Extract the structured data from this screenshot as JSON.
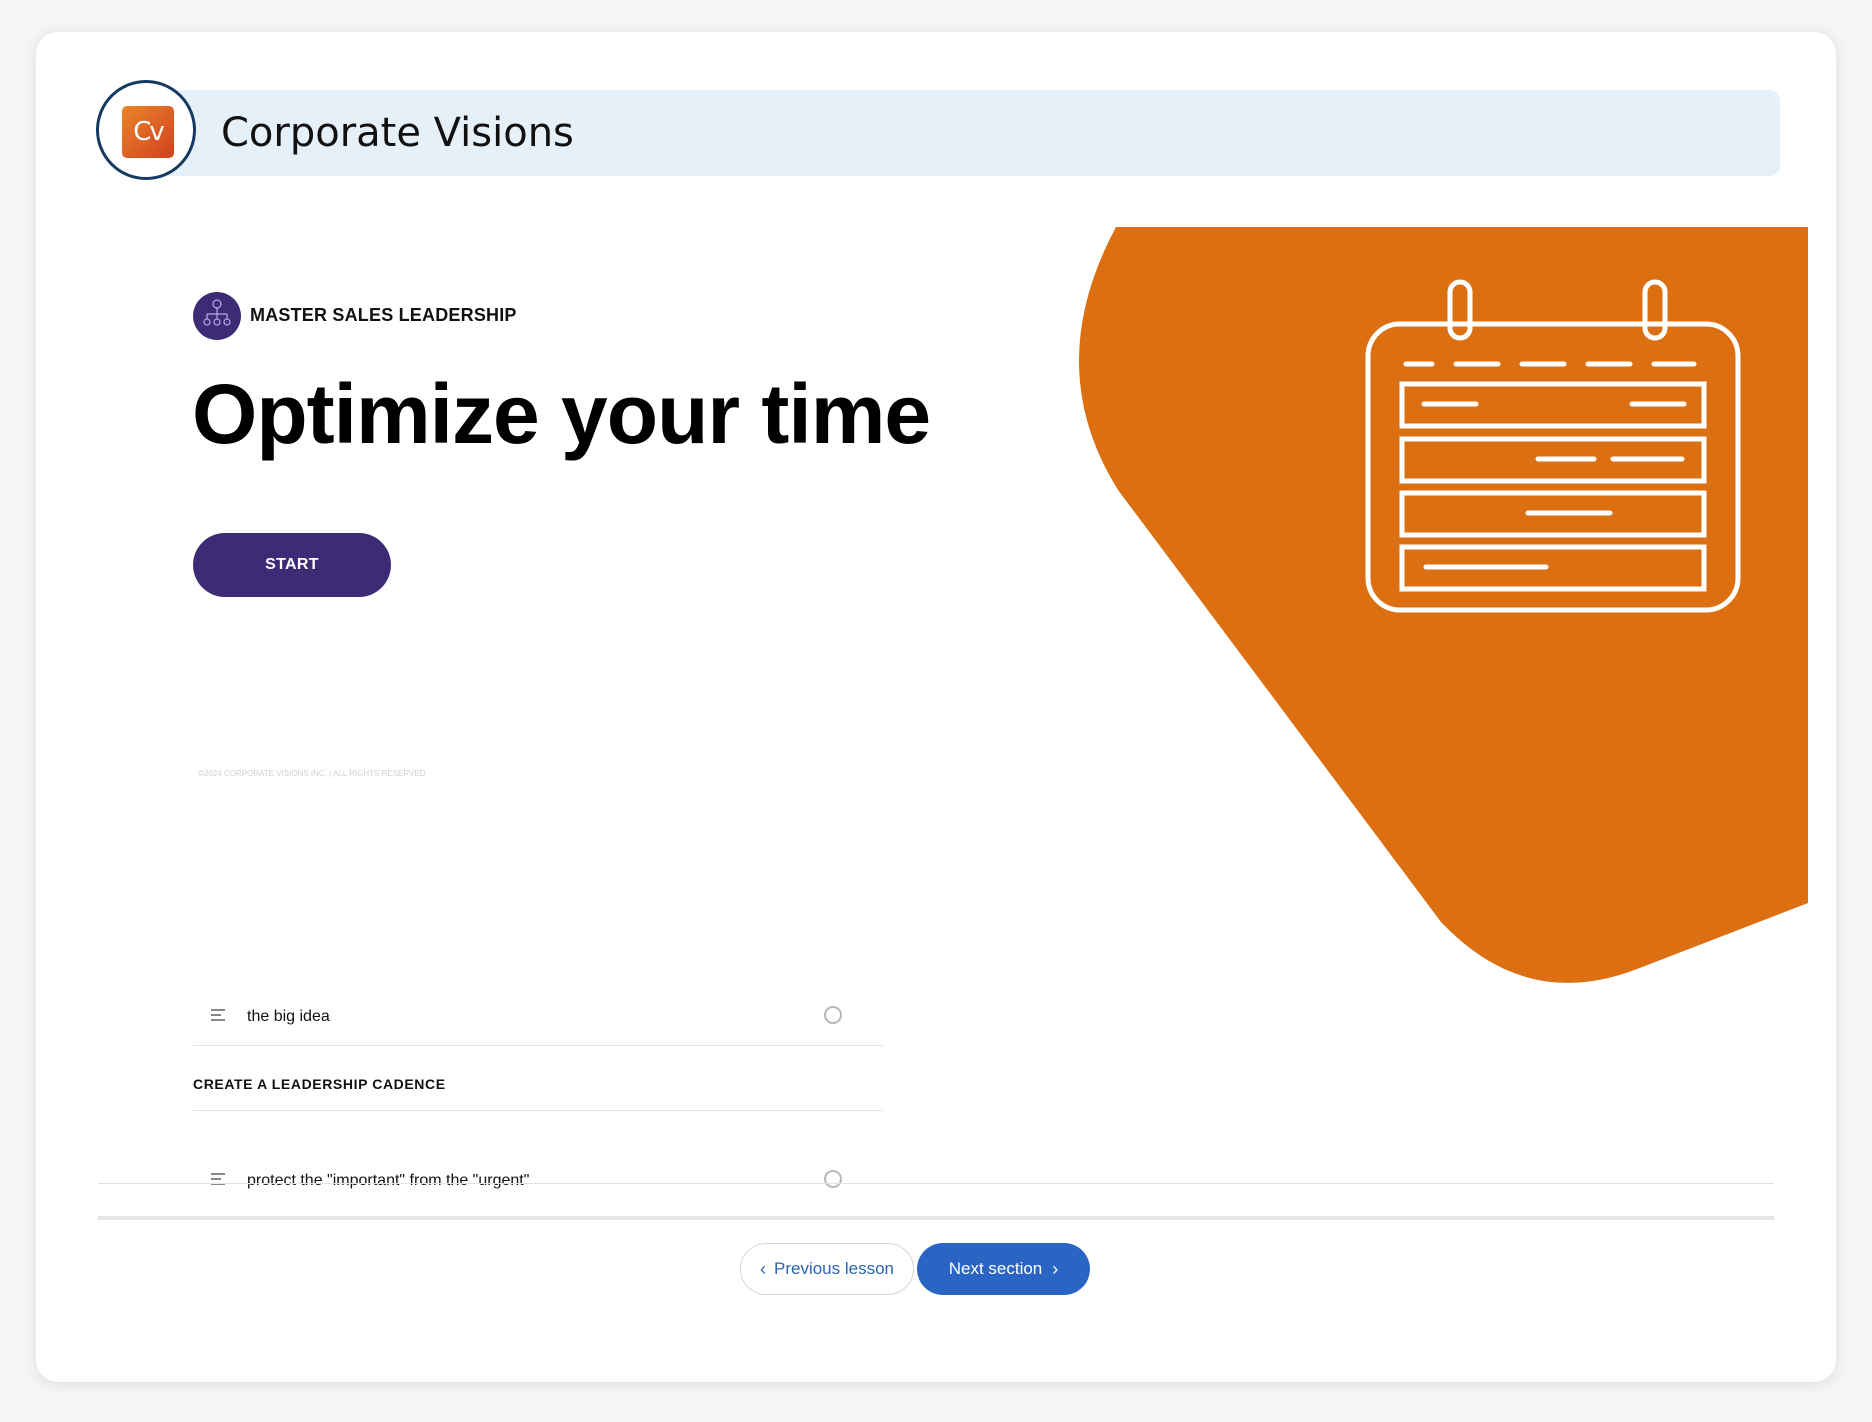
{
  "header": {
    "logo_text": "Cv",
    "brand_title": "Corporate Visions"
  },
  "hero": {
    "course_label": "MASTER SALES LEADERSHIP",
    "lesson_title": "Optimize your time",
    "start_label": "START",
    "copyright": "©2024 CORPORATE VISIONS INC. | ALL RIGHTS RESERVED",
    "art_icon": "calendar-icon",
    "art_color": "#db6f12"
  },
  "outline": {
    "items": [
      {
        "label": "the big idea",
        "icon": "text-lines-icon",
        "status": "not-started"
      }
    ],
    "sections": [
      {
        "heading": "CREATE A LEADERSHIP CADENCE",
        "items": [
          {
            "label": "protect the \"important\" from the \"urgent\"",
            "icon": "text-lines-icon",
            "status": "not-started"
          }
        ]
      }
    ]
  },
  "footer_nav": {
    "previous_label": "Previous lesson",
    "next_label": "Next section"
  },
  "colors": {
    "primary_purple": "#3d2c75",
    "accent_orange": "#db6f12",
    "header_bg": "#e6f0f9",
    "nav_blue": "#2a65c4",
    "logo_ring": "#143a63"
  }
}
